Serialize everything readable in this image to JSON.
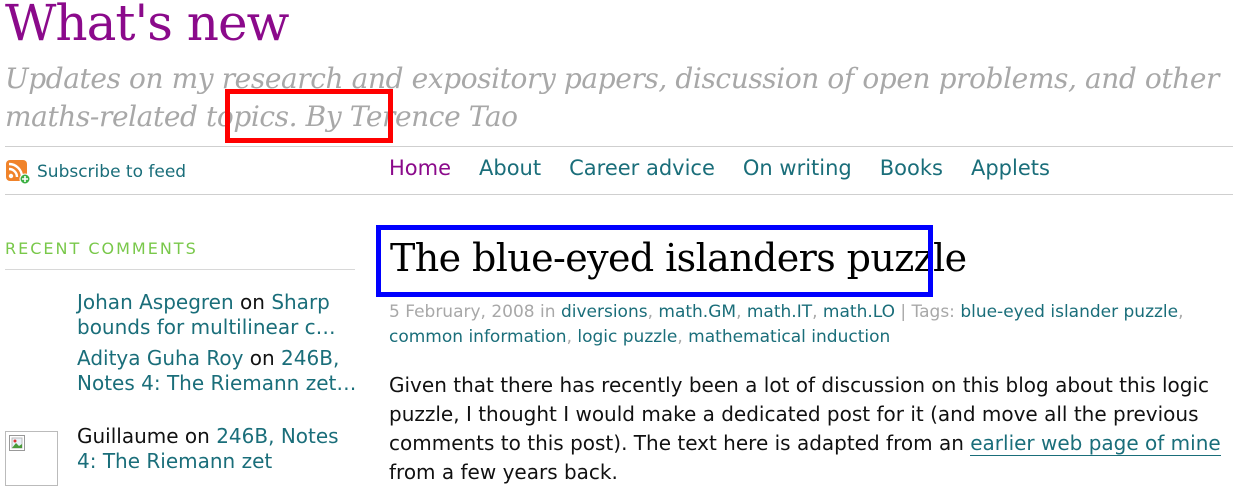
{
  "header": {
    "title": "What's new",
    "tagline_prefix": "Updates on my research and expository papers, discussion of open problems, and other maths-related topics. By ",
    "author": "Terence Tao"
  },
  "subscribe": {
    "label": "Subscribe to feed",
    "icon": "rss-feed-icon"
  },
  "nav": {
    "items": [
      {
        "label": "Home"
      },
      {
        "label": "About"
      },
      {
        "label": "Career advice"
      },
      {
        "label": "On writing"
      },
      {
        "label": "Books"
      },
      {
        "label": "Applets"
      }
    ]
  },
  "sidebar": {
    "heading": "RECENT COMMENTS",
    "comments": [
      {
        "author": "Johan Aspegren",
        "on": " on ",
        "post": "Sharp bounds for multilinear c…"
      },
      {
        "author": "Aditya Guha Roy",
        "on": " on ",
        "post": "246B, Notes 4: The Riemann zet…"
      },
      {
        "author": "Guillaume",
        "on": " on ",
        "post": "246B, Notes 4: The Riemann zet"
      }
    ]
  },
  "post": {
    "title": "The blue-eyed islanders puzzle",
    "date": "5 February, 2008",
    "in_word": " in ",
    "categories": [
      "diversions",
      "math.GM",
      "math.IT",
      "math.LO"
    ],
    "tags_label": " | Tags: ",
    "tags": [
      "blue-eyed islander puzzle",
      "common information",
      "logic puzzle",
      "mathematical induction"
    ],
    "body_prefix": "Given that there has recently been a lot of discussion on this blog about this logic puzzle, I thought I would make a dedicated post for it (and move all the previous comments to this post). The text here is adapted from an ",
    "body_link": "earlier web page of mine",
    "body_suffix": " from a few years back."
  },
  "colors": {
    "title": "#8b0a8b",
    "link": "#1a6e7a",
    "tagline": "#a8a8a8",
    "sidebar_heading": "#79c84a",
    "highlight_red": "#ff0000",
    "highlight_blue": "#0000ff"
  }
}
